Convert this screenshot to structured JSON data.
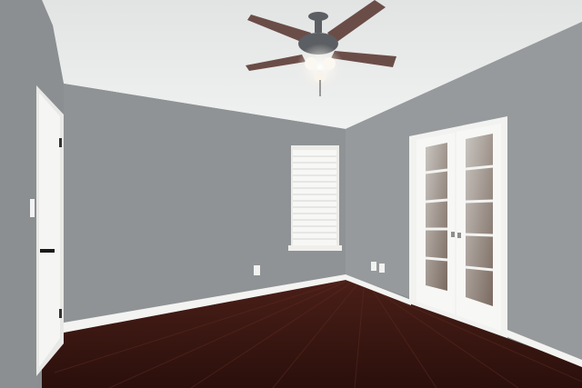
{
  "scene": {
    "subject": "empty-room",
    "colors": {
      "wall_left": "#8d9193",
      "wall_back": "#8f9395",
      "wall_right": "#979b9d",
      "ceiling": "#e9eaea",
      "floor": "#3a1712",
      "trim": "#f3f3f1",
      "fan_blade": "#6b4d48",
      "fan_body": "#5b5e62"
    },
    "elements": [
      "ceiling-fan",
      "window-blinds",
      "french-doors",
      "door",
      "hardwood-floor",
      "baseboard",
      "wall-outlet",
      "light-switch"
    ]
  }
}
